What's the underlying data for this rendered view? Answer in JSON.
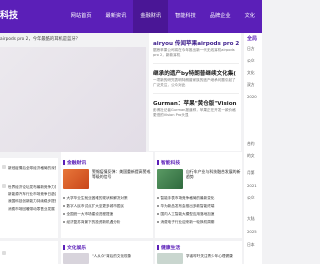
{
  "header": {
    "logo": "科技",
    "nav": [
      {
        "label": "网站首页"
      },
      {
        "label": "最新资讯"
      },
      {
        "label": "金融财讯"
      },
      {
        "label": "智能科技"
      },
      {
        "label": "品牌企业"
      },
      {
        "label": "文化"
      }
    ]
  },
  "subline": "airpods pro 2，今年最酷的耳机是蓝牙？",
  "headlines": [
    {
      "title": "airyou 传闻苹果airpods pro 2，",
      "desc": "据悉苹果公司将在今年推出新一代无线耳机airpods pro 2，新款耳机"
    },
    {
      "title": "继承的遗产by特朗普继续文化集(",
      "desc": "一项新的研究表明特朗普家族的遗产继承问题引起了广泛关注，公众对此"
    },
    {
      "title": "Gurman：苹果\"黄仓版\"Vision",
      "desc": "彭博社记者Gurman报道称，苹果正在开发一款价格更低的Vision Pro头显"
    }
  ],
  "sidebar": {
    "title": "全局",
    "items": [
      "日方",
      "公众",
      "文化",
      "双方",
      "2020",
      "合约",
      "的文",
      "月第",
      "2021",
      "公众",
      "大陆",
      "2025",
      "日本"
    ]
  },
  "sections": [
    {
      "title": "金融财讯",
      "lead": "警惕疫情反弹：美国重新提高警戒等级的信号",
      "items": [
        "大学毕业生就业困难的现状和解决对策",
        "数字人民币试点扩大至更多城市居民",
        "全国统一大市场建设进程提速",
        "经济复苏背景下的投资新机遇分析"
      ]
    },
    {
      "title": "智能科技",
      "lead": "自行车产业与科技融合发展的新趋势",
      "items": [
        "智能手表市场竞争格局的最新变化",
        "华为新品发布会推出多款智能终端",
        "国内人工智能大模型应用落地加速",
        "消费电子行业迎来新一轮换机周期"
      ]
    }
  ],
  "left_list": [
    "新冠疫情后全球经济格局的深刻变化",
    "世界经济论坛发布最新竞争力排名",
    "新能源汽车行业市场竞争日趋激烈",
    "我国科技创新能力持续稳步提升",
    "消费市场回暖带动零售业发展"
  ],
  "bottom_sections": [
    {
      "title": "文化娱乐",
      "lead": "\"人从众\"背后的文化现象"
    },
    {
      "title": "健康生活",
      "lead": "学者呼吁关注青少年心理健康"
    }
  ],
  "colors": {
    "brand": "#5b1fb8",
    "brand_dark": "#4a1696"
  }
}
